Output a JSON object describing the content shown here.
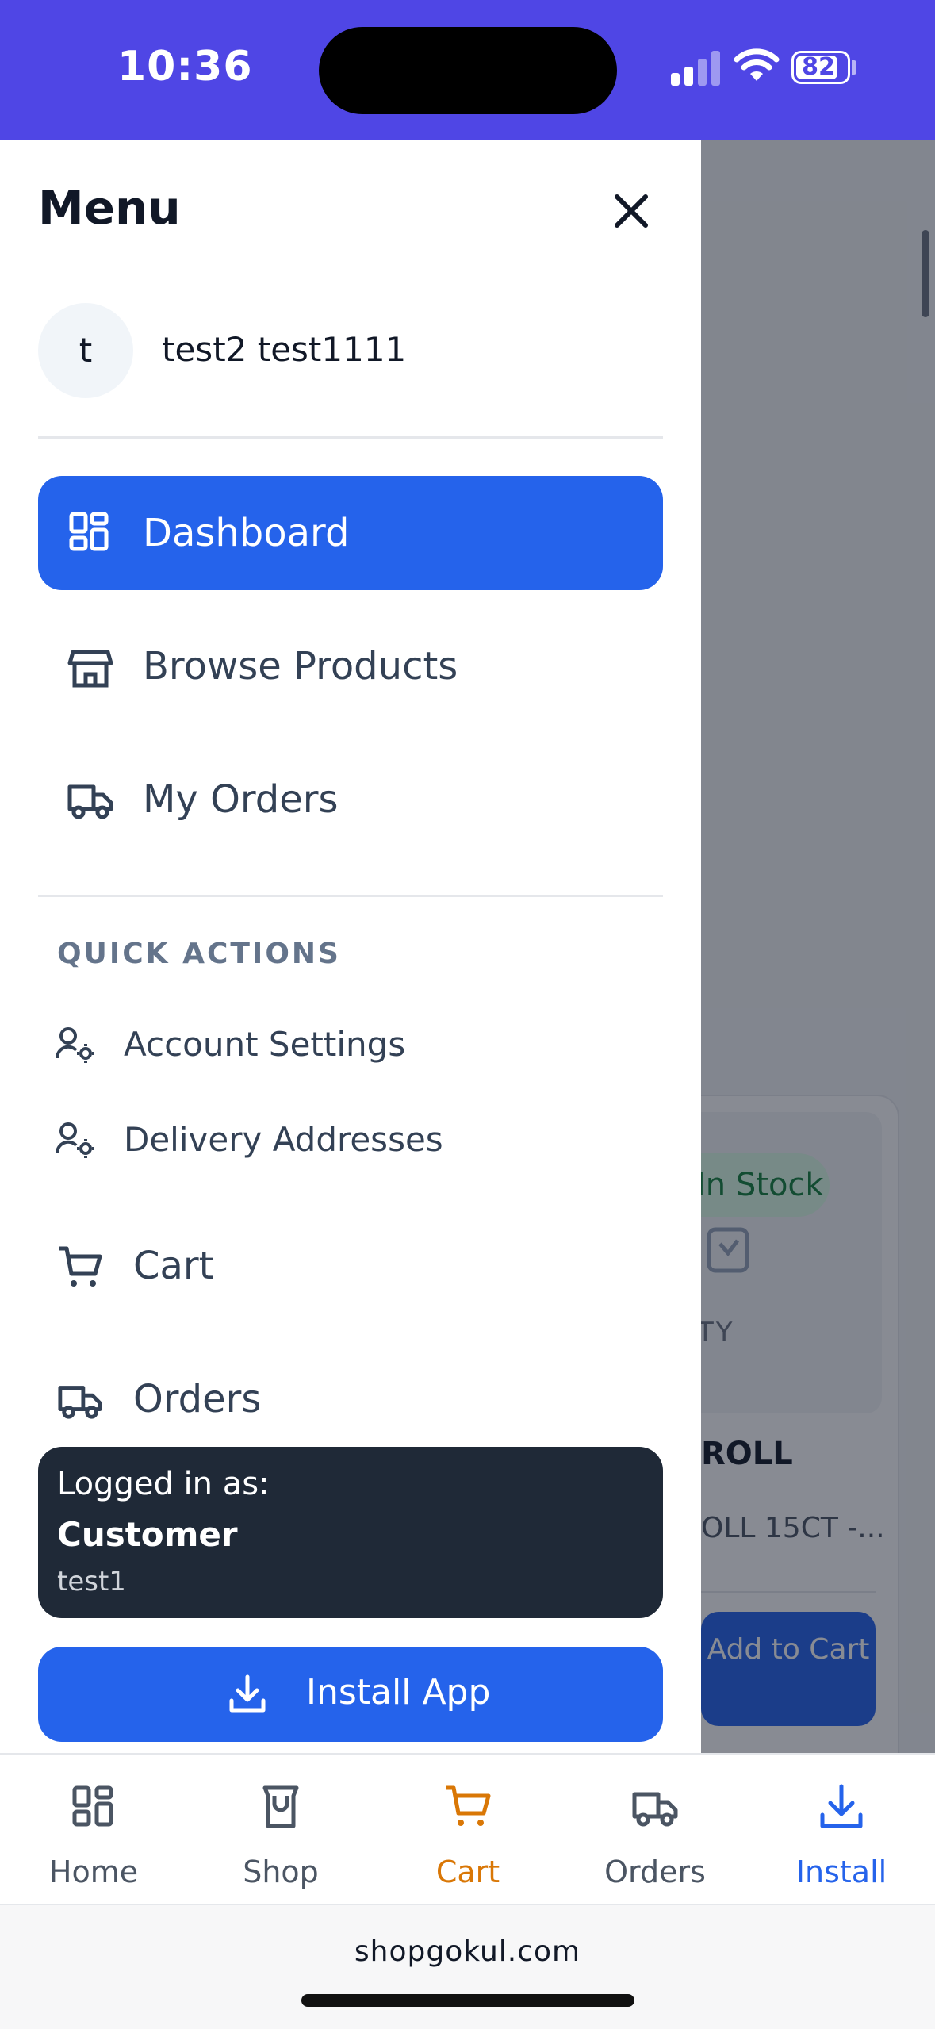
{
  "status_bar": {
    "time": "10:36",
    "battery": "82",
    "background_color": "#4f46e5"
  },
  "background_page": {
    "stock_label": "In Stock",
    "caption": "ITY",
    "product_title": "ROLL",
    "product_sub": "OLL 15CT -...",
    "add_to_cart": "Add to Cart"
  },
  "drawer": {
    "title": "Menu",
    "close_icon": "close-icon",
    "user": {
      "avatar_initial": "t",
      "name": "test2 test1111"
    },
    "nav": [
      {
        "label": "Dashboard",
        "icon": "dashboard-icon",
        "active": true
      },
      {
        "label": "Browse Products",
        "icon": "store-icon",
        "active": false
      },
      {
        "label": "My Orders",
        "icon": "truck-icon",
        "active": false
      }
    ],
    "quick_actions": {
      "heading": "QUICK ACTIONS",
      "items": [
        {
          "label": "Account Settings",
          "icon": "user-cog-icon"
        },
        {
          "label": "Delivery Addresses",
          "icon": "user-cog-icon"
        }
      ]
    },
    "links": [
      {
        "label": "Cart",
        "icon": "cart-icon"
      },
      {
        "label": "Orders",
        "icon": "truck-icon"
      }
    ],
    "logged_in": {
      "label": "Logged in as:",
      "role": "Customer",
      "username": "test1"
    },
    "install_button": {
      "label": "Install App",
      "icon": "download-icon"
    }
  },
  "tab_bar": {
    "tabs": [
      {
        "label": "Home",
        "icon": "home-grid-icon",
        "color": "#4b5563"
      },
      {
        "label": "Shop",
        "icon": "shop-bag-icon",
        "color": "#4b5563"
      },
      {
        "label": "Cart",
        "icon": "cart-icon",
        "color": "#d97706"
      },
      {
        "label": "Orders",
        "icon": "truck-icon",
        "color": "#4b5563"
      },
      {
        "label": "Install",
        "icon": "download-icon",
        "color": "#2563eb"
      }
    ]
  },
  "browser": {
    "url": "shopgokul.com"
  },
  "colors": {
    "primary": "#2563eb",
    "dark_panel": "#1f2937",
    "cart_accent": "#d97706"
  }
}
